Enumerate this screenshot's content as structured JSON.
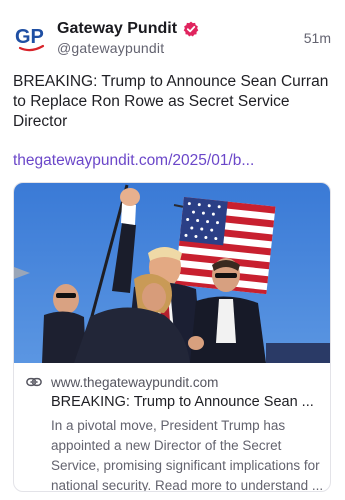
{
  "author": {
    "display_name": "Gateway Pundit",
    "handle": "@gatewaypundit",
    "avatar_text": "GP",
    "verified_icon": "verified-badge-icon",
    "verified_color": "#e0245e"
  },
  "post": {
    "timestamp": "51m",
    "headline": "BREAKING: Trump to Announce Sean Curran to Replace Ron Rowe as Secret Service Director",
    "link_text": "thegatewaypundit.com/2025/01/b..."
  },
  "link_card": {
    "domain_icon": "link-icon",
    "domain": "www.thegatewaypundit.com",
    "title": "BREAKING: Trump to Announce Sean ...",
    "description": "In a pivotal move, President Trump has appointed a new Director of the Secret Service, promising significant implications for national security. Read more to understand ..."
  },
  "colors": {
    "accent_link": "#6b47c9",
    "avatar_blue": "#1f4fa3",
    "avatar_red": "#d8232a",
    "sky_blue": "#3f7fd8"
  }
}
